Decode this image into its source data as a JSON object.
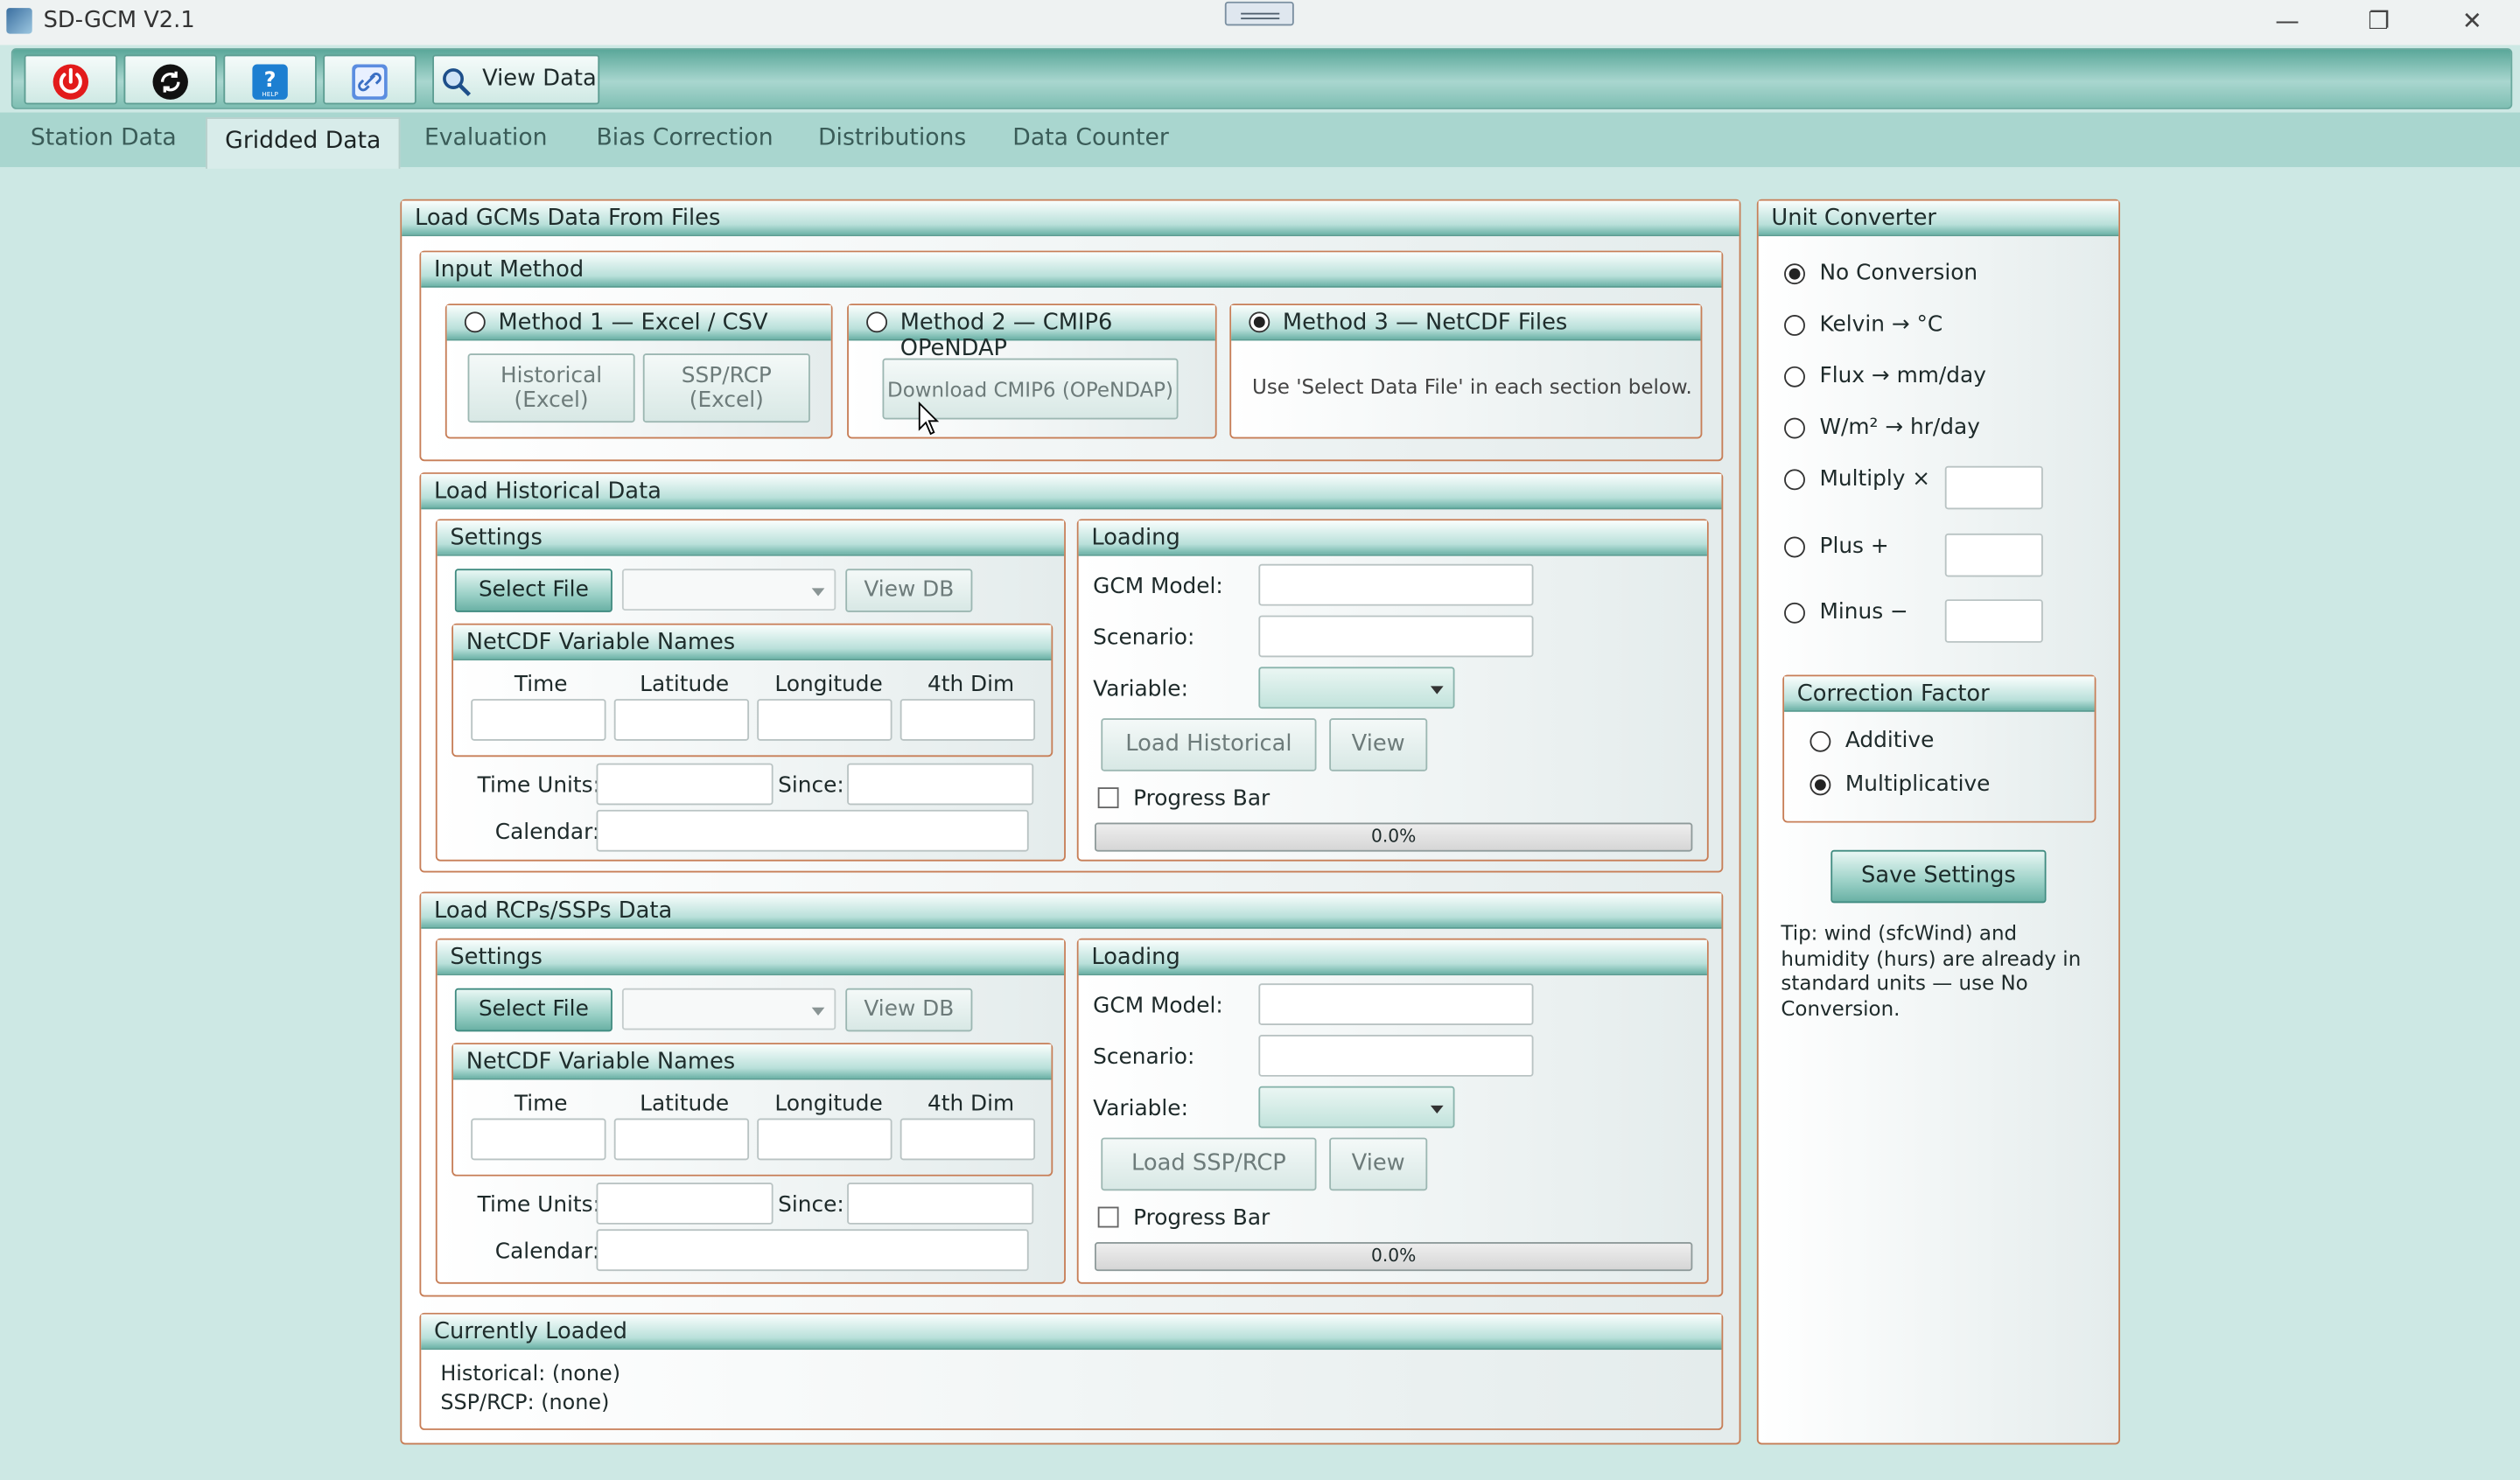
{
  "window": {
    "title": "SD-GCM V2.1",
    "minimize": "—",
    "maximize": "❐",
    "close": "✕"
  },
  "toolbar": {
    "view_data": "View Data"
  },
  "tabs": [
    "Station Data",
    "Gridded Data",
    "Evaluation",
    "Bias Correction",
    "Distributions",
    "Data Counter"
  ],
  "load_panel": {
    "title": "Load GCMs Data From Files",
    "input_method": {
      "title": "Input Method",
      "m1": {
        "label": "Method 1 — Excel / CSV",
        "hist": "Historical\n(Excel)",
        "ssp": "SSP/RCP\n(Excel)"
      },
      "m2": {
        "label": "Method 2 — CMIP6 OPeNDAP",
        "download": "Download CMIP6 (OPeNDAP)"
      },
      "m3": {
        "label": "Method 3 — NetCDF Files",
        "hint": "Use 'Select Data File' in each section below."
      }
    }
  },
  "historical": {
    "title": "Load Historical Data",
    "settings": "Settings",
    "select_file": "Select File",
    "view_db": "View DB",
    "netcdf_title": "NetCDF Variable Names",
    "cols": [
      "Time",
      "Latitude",
      "Longitude",
      "4th Dim"
    ],
    "time_units": "Time Units:",
    "since": "Since:",
    "calendar": "Calendar:",
    "loading": "Loading",
    "gcm_model": "GCM Model:",
    "scenario": "Scenario:",
    "variable": "Variable:",
    "load_btn": "Load Historical",
    "view": "View",
    "progress_label": "Progress Bar",
    "progress": "0.0%"
  },
  "ssp": {
    "title": "Load RCPs/SSPs Data",
    "settings": "Settings",
    "select_file": "Select File",
    "view_db": "View DB",
    "netcdf_title": "NetCDF Variable Names",
    "cols": [
      "Time",
      "Latitude",
      "Longitude",
      "4th Dim"
    ],
    "time_units": "Time Units:",
    "since": "Since:",
    "calendar": "Calendar:",
    "loading": "Loading",
    "gcm_model": "GCM Model:",
    "scenario": "Scenario:",
    "variable": "Variable:",
    "load_btn": "Load SSP/RCP",
    "view": "View",
    "progress_label": "Progress Bar",
    "progress": "0.0%"
  },
  "current": {
    "title": "Currently Loaded",
    "historical": "Historical: (none)",
    "ssp": "SSP/RCP: (none)"
  },
  "unit": {
    "title": "Unit Converter",
    "options": [
      "No Conversion",
      "Kelvin → °C",
      "Flux → mm/day",
      "W/m² → hr/day",
      "Multiply ×",
      "Plus +",
      "Minus −"
    ],
    "selected": "No Conversion",
    "cf_title": "Correction Factor",
    "cf_options": [
      "Additive",
      "Multiplicative"
    ],
    "cf_selected": "Multiplicative",
    "save": "Save Settings",
    "tip": "Tip: wind (sfcWind) and humidity (hurs) are already in standard units — use No Conversion."
  }
}
